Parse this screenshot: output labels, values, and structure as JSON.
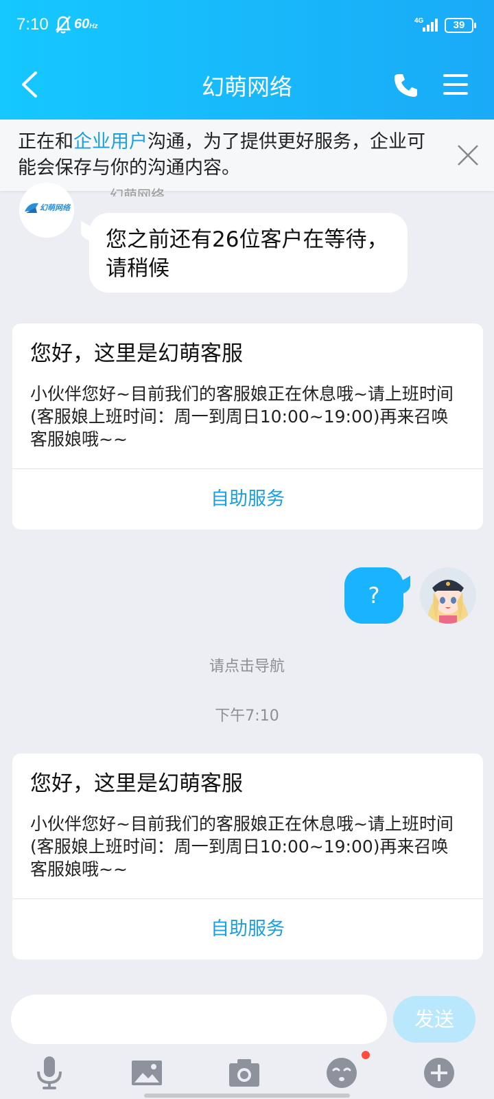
{
  "status_bar": {
    "time": "7:10",
    "refresh": "60",
    "refresh_unit": "Hz",
    "network": "4G",
    "battery": "39"
  },
  "nav": {
    "title": "幻萌网络",
    "back_icon": "chevron-left-icon",
    "phone_icon": "phone-icon",
    "menu_icon": "menu-icon"
  },
  "notice": {
    "prefix": "正在和",
    "link": "企业用户",
    "suffix": "沟通，为了提供更好服务，企业可能会保存与你的沟通内容。"
  },
  "chat": {
    "sender_name": "幻萌网络",
    "avatar_logo": "幻萌网络",
    "queue_message": "您之前还有26位客户在等待，请稍候",
    "card1": {
      "title": "您好，这里是幻萌客服",
      "body": "小伙伴您好~目前我们的客服娘正在休息哦~请上班时间(客服娘上班时间：周一到周日10:00~19:00)再来召唤客服娘哦~~",
      "action": "自助服务"
    },
    "user_message": "?",
    "system_hint": "请点击导航",
    "timestamp": "下午7:10",
    "card2": {
      "title": "您好，这里是幻萌客服",
      "body": "小伙伴您好~目前我们的客服娘正在休息哦~请上班时间(客服娘上班时间：周一到周日10:00~19:00)再来召唤客服娘哦~~",
      "action": "自助服务"
    }
  },
  "input": {
    "value": "",
    "placeholder": "",
    "send_label": "发送"
  },
  "toolbar": [
    "microphone-icon",
    "image-icon",
    "camera-icon",
    "emoji-icon",
    "plus-icon"
  ],
  "colors": {
    "accent": "#1a9fe0",
    "header_start": "#15c8ff",
    "header_end": "#1aaaf7",
    "user_bubble": "#1ab3ff",
    "send_disabled": "#b9e7fb",
    "badge": "#ff4a3d"
  }
}
